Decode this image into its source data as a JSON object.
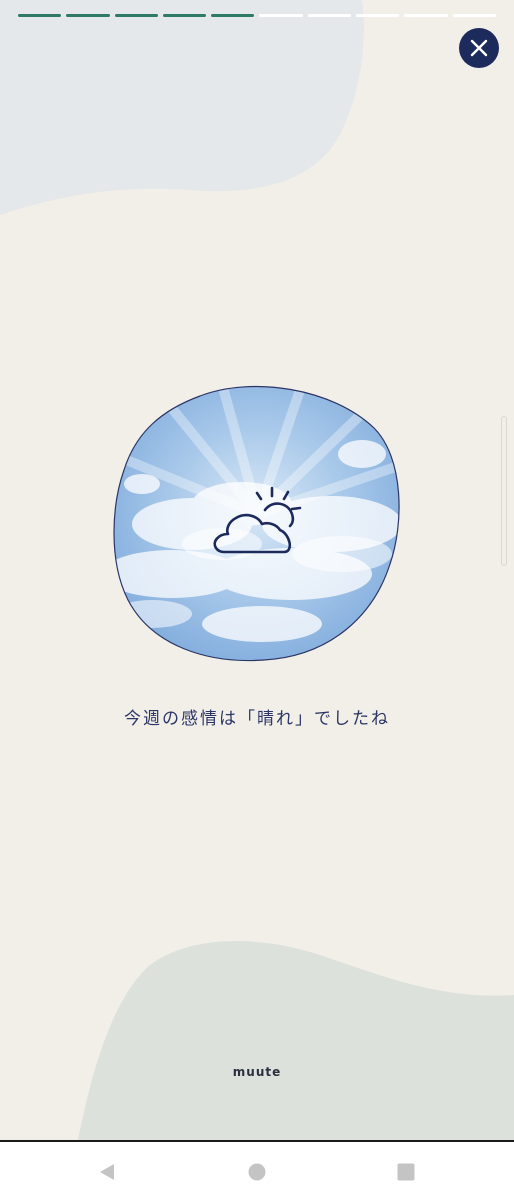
{
  "progress": {
    "total_segments": 10,
    "completed_segments": 5
  },
  "colors": {
    "background": "#f2efe8",
    "accent_progress": "#2f7a66",
    "close_button": "#1c2a5c",
    "text": "#2b3566"
  },
  "close_button": {
    "icon": "close-icon"
  },
  "result": {
    "weather_icon": "partly-sunny-icon",
    "message": "今週の感情は「晴れ」でしたね"
  },
  "brand": {
    "logo_text": "muute"
  },
  "system_nav": {
    "back_icon": "back-triangle-icon",
    "home_icon": "home-circle-icon",
    "recents_icon": "recents-square-icon"
  }
}
